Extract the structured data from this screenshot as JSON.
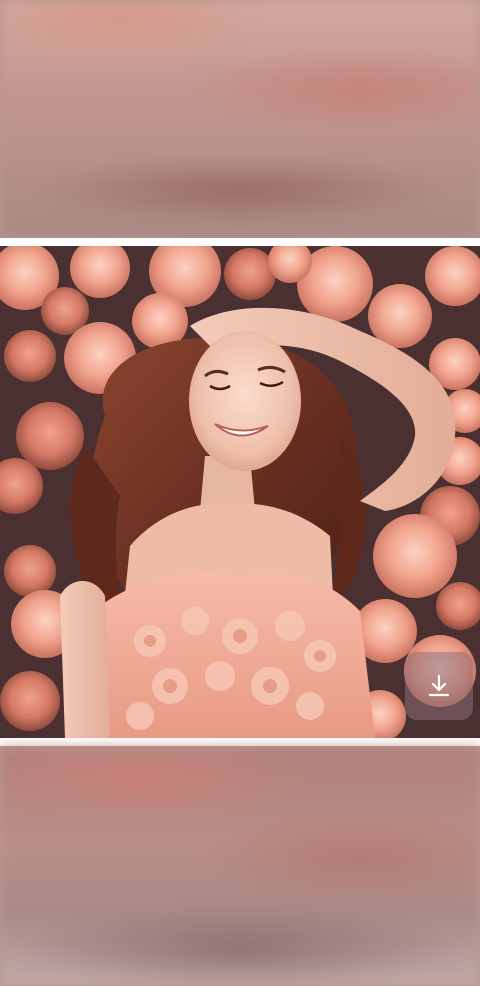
{
  "viewer": {
    "photo_subject": "woman-lying-among-peach-roses",
    "download_icon": "download-icon"
  },
  "colors": {
    "frame": "#ffffff",
    "rose": "#f0a28c",
    "rose_light": "#f7c4b0",
    "hair": "#6e3424",
    "skin": "#f2c7b4",
    "dress": "#f1a893",
    "button_bg": "#8c6e76"
  }
}
